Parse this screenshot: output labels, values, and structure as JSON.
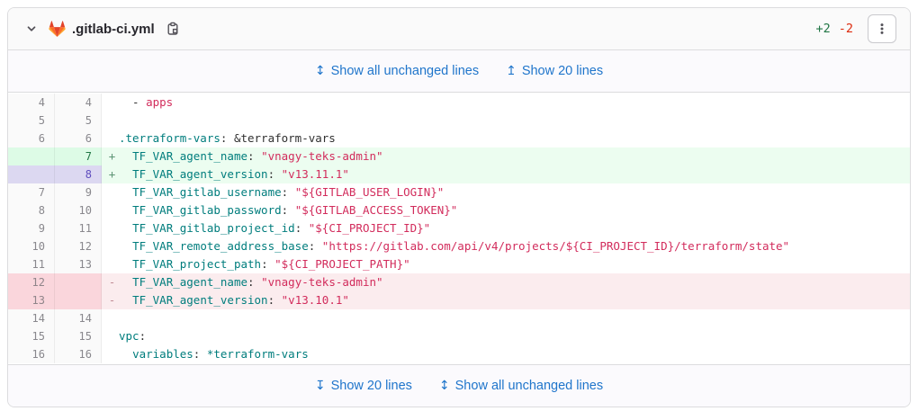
{
  "header": {
    "file_name": ".gitlab-ci.yml",
    "additions": "+2",
    "deletions": "-2"
  },
  "expanders": {
    "top": [
      {
        "icon": "↕",
        "label": "Show all unchanged lines"
      },
      {
        "icon": "↥",
        "label": "Show 20 lines"
      }
    ],
    "bottom": [
      {
        "icon": "↧",
        "label": "Show 20 lines"
      },
      {
        "icon": "↕",
        "label": "Show all unchanged lines"
      }
    ]
  },
  "colors": {
    "link": "#1f75cb",
    "added_text": "#217645",
    "removed_text": "#dd2b0e",
    "added_line_bg": "#ecfdf0",
    "added_gutter_bg": "#ddfbe6",
    "removed_line_bg": "#fbecee",
    "removed_gutter_bg": "#fad6dc",
    "selected_gutter_bg": "#dcd8f1",
    "key_color": "#007d7d",
    "string_color": "#d22c5c"
  },
  "icons": {
    "collapse": "chevron-down-icon",
    "logo": "gitlab-tanuki-icon",
    "copy": "copy-to-clipboard-icon",
    "options": "kebab-menu-icon"
  },
  "diff": {
    "lines": [
      {
        "old": "4",
        "new": "4",
        "type": "context",
        "selected": false,
        "marker": "",
        "tokens": [
          [
            "  - ",
            "plain"
          ],
          [
            "apps",
            "str"
          ]
        ]
      },
      {
        "old": "5",
        "new": "5",
        "type": "context",
        "selected": false,
        "marker": "",
        "tokens": []
      },
      {
        "old": "6",
        "new": "6",
        "type": "context",
        "selected": false,
        "marker": "",
        "tokens": [
          [
            ".terraform-vars",
            "key"
          ],
          [
            ":",
            "plain"
          ],
          [
            " &terraform-vars",
            "plain"
          ]
        ]
      },
      {
        "old": "",
        "new": "7",
        "type": "added",
        "selected": false,
        "marker": "+",
        "tokens": [
          [
            "  ",
            "plain"
          ],
          [
            "TF_VAR_agent_name",
            "key"
          ],
          [
            ": ",
            "plain"
          ],
          [
            "\"vnagy-teks-admin\"",
            "str"
          ]
        ]
      },
      {
        "old": "",
        "new": "8",
        "type": "added",
        "selected": true,
        "marker": "+",
        "tokens": [
          [
            "  ",
            "plain"
          ],
          [
            "TF_VAR_agent_version",
            "key"
          ],
          [
            ": ",
            "plain"
          ],
          [
            "\"v13.11.1\"",
            "str"
          ]
        ]
      },
      {
        "old": "7",
        "new": "9",
        "type": "context",
        "selected": false,
        "marker": "",
        "tokens": [
          [
            "  ",
            "plain"
          ],
          [
            "TF_VAR_gitlab_username",
            "key"
          ],
          [
            ": ",
            "plain"
          ],
          [
            "\"${GITLAB_USER_LOGIN}\"",
            "str"
          ]
        ]
      },
      {
        "old": "8",
        "new": "10",
        "type": "context",
        "selected": false,
        "marker": "",
        "tokens": [
          [
            "  ",
            "plain"
          ],
          [
            "TF_VAR_gitlab_password",
            "key"
          ],
          [
            ": ",
            "plain"
          ],
          [
            "\"${GITLAB_ACCESS_TOKEN}\"",
            "str"
          ]
        ]
      },
      {
        "old": "9",
        "new": "11",
        "type": "context",
        "selected": false,
        "marker": "",
        "tokens": [
          [
            "  ",
            "plain"
          ],
          [
            "TF_VAR_gitlab_project_id",
            "key"
          ],
          [
            ": ",
            "plain"
          ],
          [
            "\"${CI_PROJECT_ID}\"",
            "str"
          ]
        ]
      },
      {
        "old": "10",
        "new": "12",
        "type": "context",
        "selected": false,
        "marker": "",
        "tokens": [
          [
            "  ",
            "plain"
          ],
          [
            "TF_VAR_remote_address_base",
            "key"
          ],
          [
            ": ",
            "plain"
          ],
          [
            "\"https://gitlab.com/api/v4/projects/${CI_PROJECT_ID}/terraform/state\"",
            "str"
          ]
        ]
      },
      {
        "old": "11",
        "new": "13",
        "type": "context",
        "selected": false,
        "marker": "",
        "tokens": [
          [
            "  ",
            "plain"
          ],
          [
            "TF_VAR_project_path",
            "key"
          ],
          [
            ": ",
            "plain"
          ],
          [
            "\"${CI_PROJECT_PATH}\"",
            "str"
          ]
        ]
      },
      {
        "old": "12",
        "new": "",
        "type": "removed",
        "selected": false,
        "marker": "-",
        "tokens": [
          [
            "  ",
            "plain"
          ],
          [
            "TF_VAR_agent_name",
            "key"
          ],
          [
            ": ",
            "plain"
          ],
          [
            "\"vnagy-teks-admin\"",
            "str"
          ]
        ]
      },
      {
        "old": "13",
        "new": "",
        "type": "removed",
        "selected": false,
        "marker": "-",
        "tokens": [
          [
            "  ",
            "plain"
          ],
          [
            "TF_VAR_agent_version",
            "key"
          ],
          [
            ": ",
            "plain"
          ],
          [
            "\"v13.10.1\"",
            "str"
          ]
        ]
      },
      {
        "old": "14",
        "new": "14",
        "type": "context",
        "selected": false,
        "marker": "",
        "tokens": []
      },
      {
        "old": "15",
        "new": "15",
        "type": "context",
        "selected": false,
        "marker": "",
        "tokens": [
          [
            "vpc",
            "key"
          ],
          [
            ":",
            "plain"
          ]
        ]
      },
      {
        "old": "16",
        "new": "16",
        "type": "context",
        "selected": false,
        "marker": "",
        "tokens": [
          [
            "  ",
            "plain"
          ],
          [
            "variables",
            "key"
          ],
          [
            ": ",
            "plain"
          ],
          [
            "*terraform-vars",
            "key"
          ]
        ]
      }
    ]
  }
}
